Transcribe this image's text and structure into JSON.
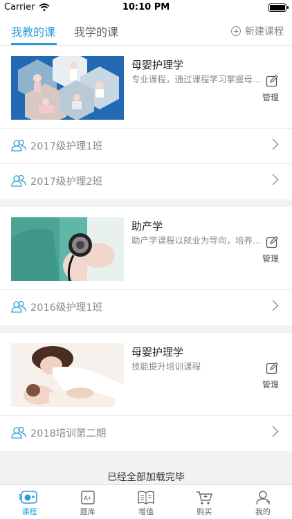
{
  "status_bar": {
    "carrier": "Carrier",
    "time": "10:10 PM"
  },
  "top_tabs": {
    "tabs": [
      "我教的课",
      "我学的课"
    ],
    "active_index": 0,
    "new_course_label": "新建课程"
  },
  "courses": [
    {
      "title": "母婴护理学",
      "description": "专业课程，通过课程学习掌握母婴护理知识",
      "manage_label": "管理",
      "classes": [
        "2017级护理1班",
        "2017级护理2班"
      ]
    },
    {
      "title": "助产学",
      "description": "助产学课程以就业为导向，培养助产技能",
      "manage_label": "管理",
      "classes": [
        "2016级护理1班"
      ]
    },
    {
      "title": "母婴护理学",
      "description": "技能提升培训课程",
      "manage_label": "管理",
      "classes": [
        "2018培训第二期"
      ]
    }
  ],
  "end_text": "已经全部加载完毕",
  "tab_bar": {
    "items": [
      "课程",
      "题库",
      "增值",
      "购买",
      "我的"
    ],
    "active_index": 0
  },
  "colors": {
    "accent": "#2a9ed8",
    "background": "#f2f2f2"
  }
}
